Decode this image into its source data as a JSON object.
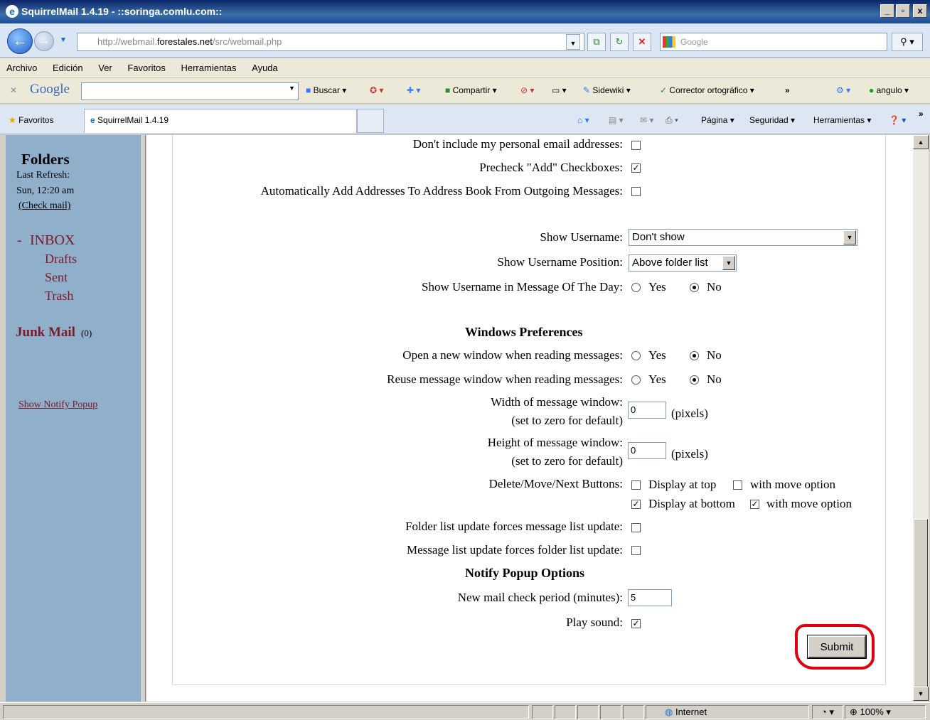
{
  "window": {
    "title": "SquirrelMail 1.4.19 - ::soringa.comlu.com::"
  },
  "address": {
    "prefix": "http://webmail.",
    "host": "forestales.net",
    "path": "/src/webmail.php",
    "search_placeholder": "Google"
  },
  "menu": [
    "Archivo",
    "Edición",
    "Ver",
    "Favoritos",
    "Herramientas",
    "Ayuda"
  ],
  "google_toolbar": {
    "logo": "Google",
    "buscar": "Buscar",
    "compartir": "Compartir",
    "sidewiki": "Sidewiki",
    "corrector": "Corrector ortográfico",
    "more": "»",
    "user": "angulo"
  },
  "favbar": {
    "favoritos": "Favoritos",
    "tab": "SquirrelMail 1.4.19",
    "pagina": "Página",
    "seguridad": "Seguridad",
    "herramientas": "Herramientas"
  },
  "sidebar": {
    "title": "Folders",
    "last_refresh": "Last Refresh:",
    "refresh_time": "Sun, 12:20 am",
    "check_mail": "(Check mail)",
    "inbox_prefix": "-",
    "inbox": "INBOX",
    "folders": [
      "Drafts",
      "Sent",
      "Trash"
    ],
    "junk": "Junk Mail",
    "junk_count": "(0)",
    "notify_link": "Show Notify Popup"
  },
  "options": {
    "dont_include_label": "Don't include my personal email addresses:",
    "precheck_label": "Precheck \"Add\" Checkboxes:",
    "auto_add_label": "Automatically Add Addresses To Address Book From Outgoing Messages:",
    "show_username_label": "Show Username:",
    "show_username_value": "Don't show",
    "username_position_label": "Show Username Position:",
    "username_position_value": "Above folder list",
    "username_motd_label": "Show Username in Message Of The Day:",
    "windows_section": "Windows Preferences",
    "new_window_label": "Open a new window when reading messages:",
    "reuse_window_label": "Reuse message window when reading messages:",
    "width_label": "Width of message window:",
    "width_sub": "(set to zero for default)",
    "width_value": "0",
    "height_label": "Height of message window:",
    "height_sub": "(set to zero for default)",
    "height_value": "0",
    "pixels": "(pixels)",
    "buttons_label": "Delete/Move/Next Buttons:",
    "display_top": "Display at top",
    "display_bottom": "Display at bottom",
    "with_move": "with move option",
    "folder_update_label": "Folder list update forces message list update:",
    "message_update_label": "Message list update forces folder list update:",
    "notify_section": "Notify Popup Options",
    "check_period_label": "New mail check period (minutes):",
    "check_period_value": "5",
    "play_sound_label": "Play sound:",
    "yes": "Yes",
    "no": "No",
    "submit": "Submit"
  },
  "status": {
    "zone": "Internet",
    "zoom": "100%"
  }
}
